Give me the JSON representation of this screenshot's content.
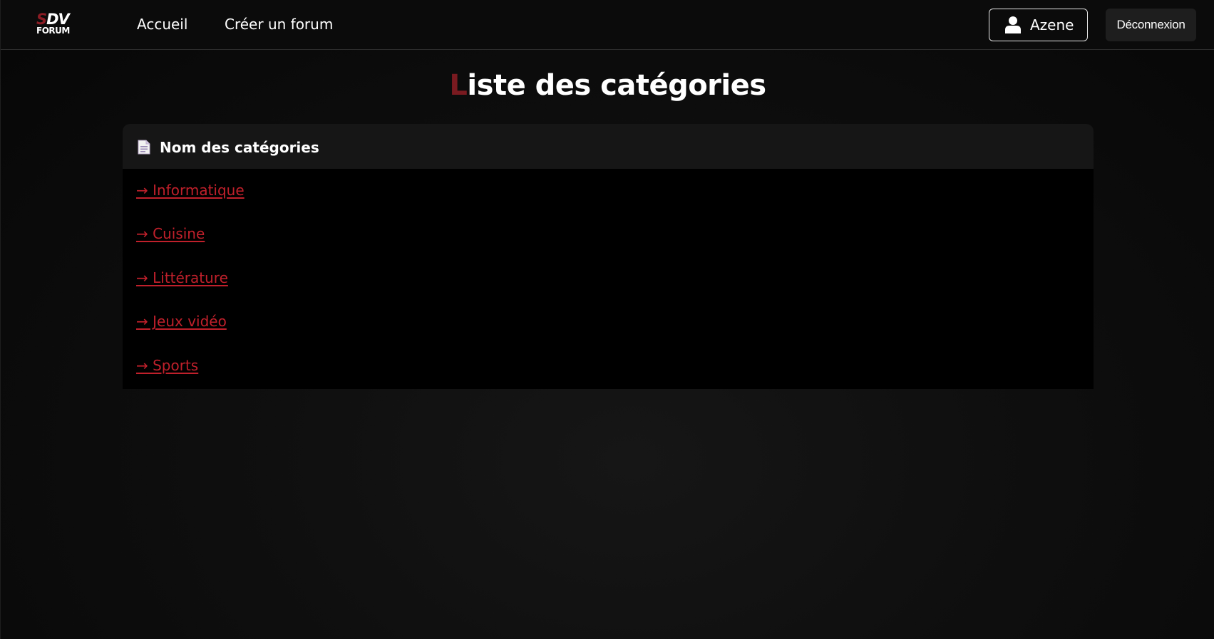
{
  "nav": {
    "logo_top_s": "S",
    "logo_top_dv": "DV",
    "logo_bottom": "FORUM",
    "home_label": "Accueil",
    "create_label": "Créer un forum",
    "user_name": "Azene",
    "logout_label": "Déconnexion"
  },
  "page": {
    "title_first_letter": "L",
    "title_rest": "iste des catégories"
  },
  "card": {
    "header_icon": "document-icon",
    "header_title": "Nom des catégories",
    "categories": [
      "→ Informatique",
      "→ Cuisine",
      "→ Littérature",
      "→ Jeux vidéo",
      "→ Sports"
    ]
  },
  "colors": {
    "accent": "#c0202b",
    "title_accent": "#7a1a20",
    "background": "#0a0a0a",
    "card_header": "#161616"
  }
}
